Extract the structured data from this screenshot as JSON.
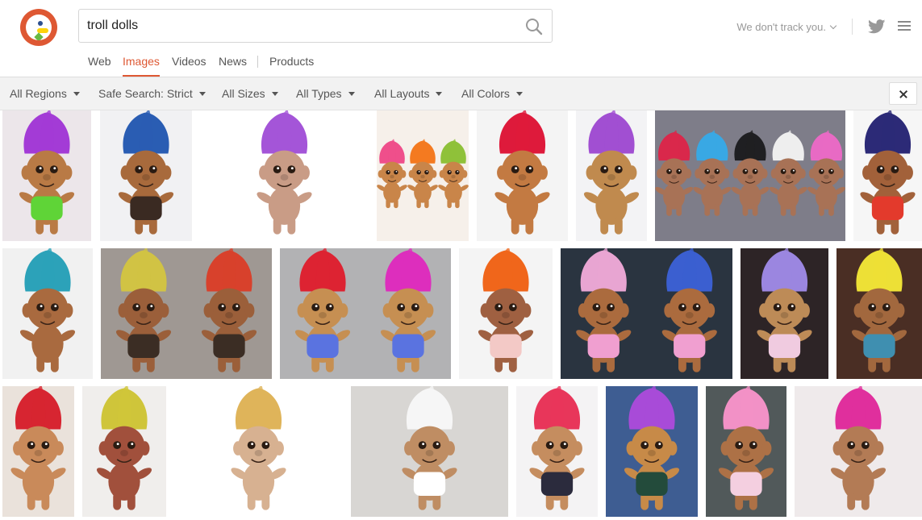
{
  "search": {
    "query": "troll dolls"
  },
  "nav": {
    "tabs": [
      "Web",
      "Images",
      "Videos",
      "News",
      "Products"
    ],
    "active": "Images"
  },
  "header": {
    "tracking_label": "We don't track you."
  },
  "filters": [
    "All Regions",
    "Safe Search: Strict",
    "All Sizes",
    "All Types",
    "All Layouts",
    "All Colors"
  ],
  "colors": {
    "accent": "#de5833",
    "filterbar": "#f2f2f2"
  },
  "icons": {
    "search": "search-icon",
    "twitter": "twitter-icon",
    "menu": "menu-icon",
    "close": "close-icon"
  },
  "results": [
    {
      "bg": "#ece6ea",
      "hair": [
        "#a33bd6"
      ],
      "skin": "#b97a45",
      "outfit": "#5fd437"
    },
    {
      "bg": "#f1f1f3",
      "hair": [
        "#2a5db3"
      ],
      "skin": "#a86a3c",
      "outfit": "#3a2a22"
    },
    {
      "bg": "#ffffff",
      "hair": [
        "#a455d8"
      ],
      "skin": "#c99c86",
      "outfit": ""
    },
    {
      "bg": "#f6f0ea",
      "hair": [
        "#ef4f8b",
        "#f47a20",
        "#8fc13a"
      ],
      "skin": "#c98549",
      "outfit": ""
    },
    {
      "bg": "#f4f4f4",
      "hair": [
        "#de1a3b"
      ],
      "skin": "#c37a42",
      "outfit": ""
    },
    {
      "bg": "#f3f3f5",
      "hair": [
        "#a14fd2"
      ],
      "skin": "#c08a4e",
      "outfit": ""
    },
    {
      "bg": "#7e7d89",
      "hair": [
        "#d9284b",
        "#39a8e4",
        "#1f1f22",
        "#eeeeee",
        "#e86ac4"
      ],
      "skin": "#a87256",
      "outfit": ""
    },
    {
      "bg": "#f6f6f6",
      "hair": [
        "#2c2a77"
      ],
      "skin": "#a2613a",
      "outfit": "#e33a2c"
    },
    {
      "bg": "#f1f1f1",
      "hair": [
        "#2ca2b9"
      ],
      "skin": "#a96a3f",
      "outfit": ""
    },
    {
      "bg": "#9f9893",
      "hair": [
        "#d1c344",
        "#d8412c"
      ],
      "skin": "#9b5f3a",
      "outfit": "#3b2d24"
    },
    {
      "bg": "#b2b2b4",
      "hair": [
        "#dd2332",
        "#dd2ebd"
      ],
      "skin": "#c68f52",
      "outfit": "#5a73e0"
    },
    {
      "bg": "#f4f4f4",
      "hair": [
        "#f0661b"
      ],
      "skin": "#9f6041",
      "outfit": "#f3c9c6"
    },
    {
      "bg": "#2a3440",
      "hair": [
        "#e8a5d2",
        "#3b5fd0"
      ],
      "skin": "#ab6b3e",
      "outfit": "#f09fd0"
    },
    {
      "bg": "#2d2426",
      "hair": [
        "#9b86e0"
      ],
      "skin": "#bd8b57",
      "outfit": "#f0cbe0"
    },
    {
      "bg": "#4a2e24",
      "hair": [
        "#ede036"
      ],
      "skin": "#a2683e",
      "outfit": "#3f8fb0"
    },
    {
      "bg": "#eae2db",
      "hair": [
        "#d72531"
      ],
      "skin": "#c98a5a",
      "outfit": ""
    },
    {
      "bg": "#f0eeec",
      "hair": [
        "#cfc53a"
      ],
      "skin": "#a1503c",
      "outfit": ""
    },
    {
      "bg": "#ffffff",
      "hair": [
        "#dfb45a"
      ],
      "skin": "#d7b191",
      "outfit": ""
    },
    {
      "bg": "#d8d6d3",
      "hair": [
        "#f6f6f6"
      ],
      "skin": "#bf8d63",
      "outfit": "#ffffff"
    },
    {
      "bg": "#f4f3f4",
      "hair": [
        "#e8365a"
      ],
      "skin": "#c58d5f",
      "outfit": "#2b2b3d"
    },
    {
      "bg": "#3e5d92",
      "hair": [
        "#a84bd8"
      ],
      "skin": "#c78a48",
      "outfit": "#234b3b"
    },
    {
      "bg": "#51595a",
      "hair": [
        "#f291c6"
      ],
      "skin": "#ad7146",
      "outfit": "#f4cfe0"
    },
    {
      "bg": "#efeaeb",
      "hair": [
        "#e02f9d"
      ],
      "skin": "#b37b55",
      "outfit": ""
    }
  ]
}
